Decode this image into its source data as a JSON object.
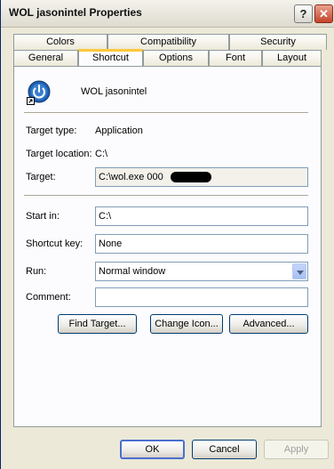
{
  "window": {
    "title": "WOL jasonintel Properties"
  },
  "titlebar": {
    "help_label": "?",
    "close_label": "✕"
  },
  "tabs": {
    "row1": [
      "Colors",
      "Compatibility",
      "Security"
    ],
    "row2": [
      "General",
      "Shortcut",
      "Options",
      "Font",
      "Layout"
    ],
    "active": "Shortcut"
  },
  "shortcut": {
    "name": "WOL jasonintel",
    "target_type_label": "Target type:",
    "target_type_value": "Application",
    "target_location_label": "Target location:",
    "target_location_value": "C:\\",
    "target_label": "Target:",
    "target_value": "C:\\wol.exe 000",
    "start_in_label": "Start in:",
    "start_in_value": "C:\\",
    "shortcut_key_label": "Shortcut key:",
    "shortcut_key_value": "None",
    "run_label": "Run:",
    "run_value": "Normal window",
    "comment_label": "Comment:",
    "comment_value": "",
    "find_target_label": "Find Target...",
    "change_icon_label": "Change Icon...",
    "advanced_label": "Advanced..."
  },
  "footer": {
    "ok_label": "OK",
    "cancel_label": "Cancel",
    "apply_label": "Apply"
  },
  "colors": {
    "power_icon": "#2060b0",
    "tab_highlight": "#ffc83c"
  }
}
